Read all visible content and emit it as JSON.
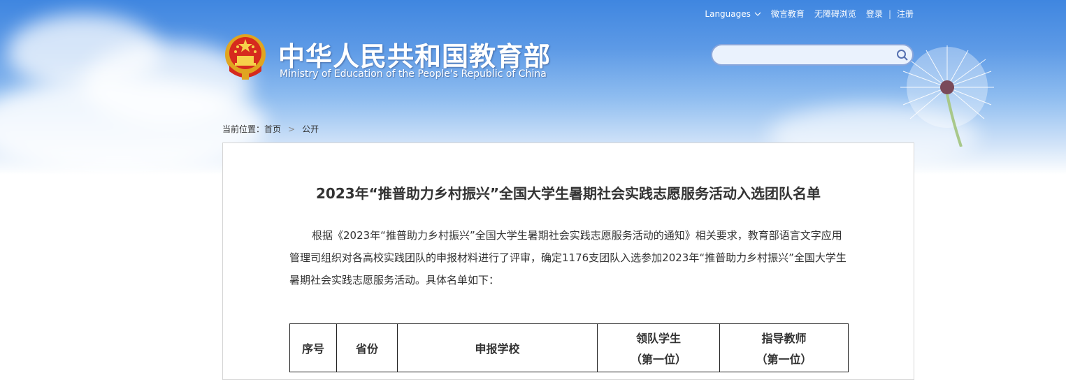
{
  "header": {
    "site_title_cn": "中华人民共和国教育部",
    "site_title_en": "Ministry of Education of the People's Republic of China",
    "links": {
      "languages": "Languages",
      "weiyan": "微言教育",
      "accessibility": "无障碍浏览",
      "login": "登录",
      "register": "注册"
    },
    "search": {
      "placeholder": "",
      "value": ""
    }
  },
  "breadcrumb": {
    "prefix": "当前位置：",
    "home": "首页",
    "separator": ">",
    "current": "公开"
  },
  "article": {
    "title": "2023年“推普助力乡村振兴”全国大学生暑期社会实践志愿服务活动入选团队名单",
    "paragraph": "根据《2023年“推普助力乡村振兴”全国大学生暑期社会实践志愿服务活动的通知》相关要求，教育部语言文字应用管理司组织对各高校实践团队的申报材料进行了评审，确定1176支团队入选参加2023年“推普助力乡村振兴”全国大学生暑期社会实践志愿服务活动。具体名单如下："
  },
  "table": {
    "headers": {
      "index": "序号",
      "province": "省份",
      "school": "申报学校",
      "leader": "领队学生",
      "leader_sub": "（第一位）",
      "teacher": "指导教师",
      "teacher_sub": "（第一位）"
    }
  },
  "colors": {
    "sky_top": "#3f86e0",
    "text": "#333333",
    "search_border": "#8aa6da"
  }
}
